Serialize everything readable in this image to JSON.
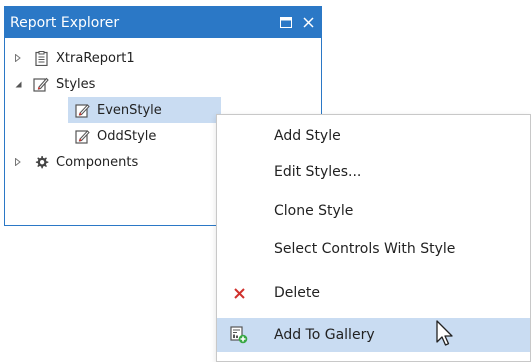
{
  "panel": {
    "title": "Report Explorer",
    "buttons": {
      "maximize": "maximize-icon",
      "close": "close-icon"
    },
    "accent_color": "#2b78c6"
  },
  "tree": {
    "items": [
      {
        "label": "XtraReport1",
        "icon": "report-icon",
        "expander": "collapsed"
      },
      {
        "label": "Styles",
        "icon": "styles-icon",
        "expander": "expanded"
      },
      {
        "label": "EvenStyle",
        "icon": "style-icon",
        "selected": true
      },
      {
        "label": "OddStyle",
        "icon": "style-icon"
      },
      {
        "label": "Components",
        "icon": "gear-icon",
        "expander": "collapsed"
      }
    ],
    "selection_color": "#c9dcf2"
  },
  "menu": {
    "items": [
      {
        "label": "Add Style",
        "icon": ""
      },
      {
        "label": "Edit Styles...",
        "icon": ""
      },
      {
        "label": "Clone Style",
        "icon": ""
      },
      {
        "label": "Select Controls With Style",
        "icon": ""
      },
      {
        "label": "Delete",
        "icon": "delete-icon"
      },
      {
        "label": "Add To Gallery",
        "icon": "add-to-gallery-icon",
        "highlighted": true
      }
    ],
    "delete_color": "#d0312d",
    "highlight_color": "#c9dcf2"
  }
}
